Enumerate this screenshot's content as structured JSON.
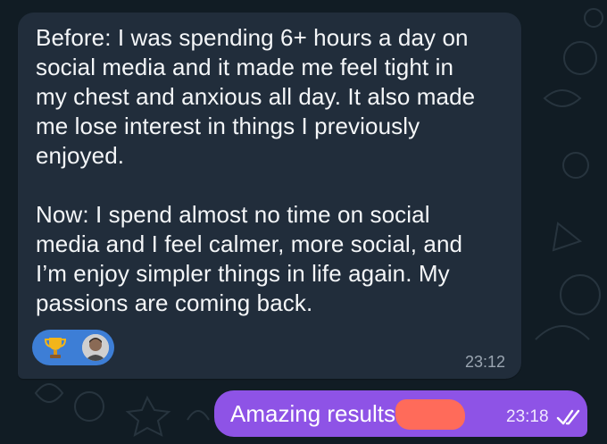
{
  "chat": {
    "incoming": {
      "text": "Before: I was spending 6+ hours a day on\nsocial media and it made me feel tight in\nmy chest and anxious all day. It also made\nme lose interest in things I previously\nenjoyed.\n\nNow: I spend almost no time on social\nmedia and I feel calmer, more social, and\nI’m enjoy simpler things in life again. My\npassions are coming back.",
      "time": "23:12",
      "reactions": [
        {
          "icon": "trophy-icon"
        },
        {
          "icon": "avatar"
        }
      ]
    },
    "outgoing": {
      "text": "Amazing results A     !",
      "time": "23:18",
      "status_icon": "double-check-icon"
    }
  },
  "colors": {
    "background": "#111c24",
    "incoming_bubble": "#212d3b",
    "outgoing_bubble": "#8e53e6",
    "reaction_bg": "#3d7ed6",
    "redaction": "#ff6b5a"
  }
}
